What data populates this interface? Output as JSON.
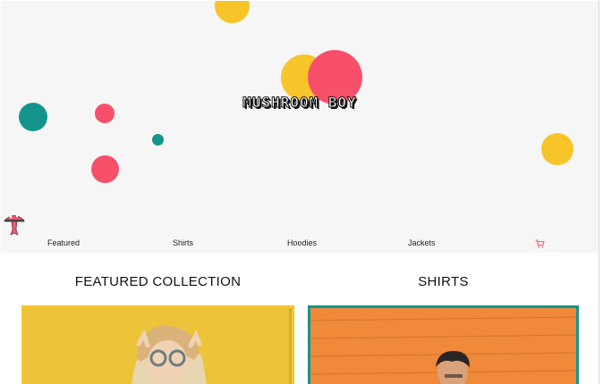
{
  "brand": {
    "logo_text": "MUSHROOM BOY",
    "colors": {
      "yellow": "#f7c52a",
      "pink": "#f8506a",
      "teal": "#13958d",
      "background": "#f6f6f6"
    }
  },
  "nav": {
    "items": [
      {
        "label": "Featured"
      },
      {
        "label": "Shirts"
      },
      {
        "label": "Hoodies"
      },
      {
        "label": "Jackets"
      }
    ],
    "cart_icon": "cart-icon"
  },
  "sections": [
    {
      "title": "FEATURED COLLECTION",
      "card_border": "#f7c52a",
      "photo_background": "#f2c93a"
    },
    {
      "title": "SHIRTS",
      "card_border": "#13958d",
      "photo_background": "#f08a3a"
    }
  ]
}
